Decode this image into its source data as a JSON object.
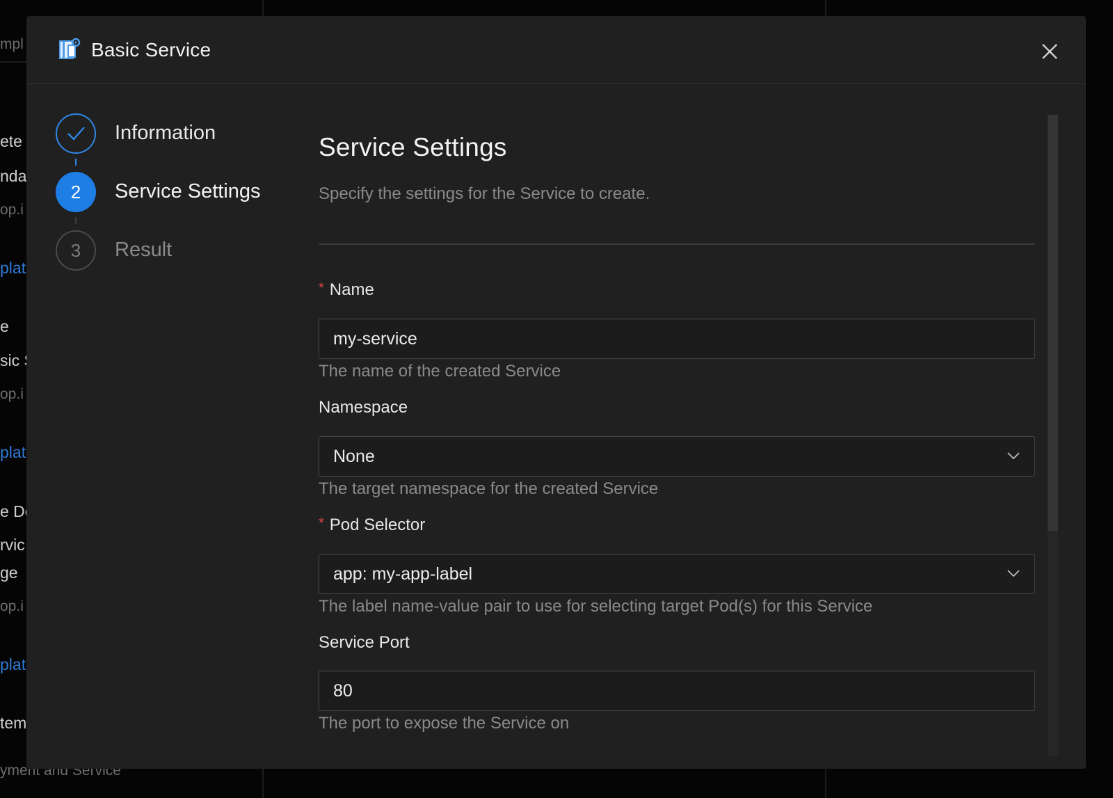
{
  "background": {
    "texts": [
      "mpl",
      "ete",
      "nda",
      "op.i",
      "plate",
      "e",
      "sic S",
      "op.i",
      "plate",
      "e De",
      "rvic",
      "ge",
      "op.i",
      "plate",
      "tem",
      "yment and Service"
    ]
  },
  "modal": {
    "title": "Basic Service",
    "app_icon": "template-gear-icon",
    "close_icon": "close-icon"
  },
  "steps": [
    {
      "number": "1",
      "label": "Information",
      "status": "done"
    },
    {
      "number": "2",
      "label": "Service Settings",
      "status": "active"
    },
    {
      "number": "3",
      "label": "Result",
      "status": "pending"
    }
  ],
  "section": {
    "title": "Service Settings",
    "description": "Specify the settings for the Service to create."
  },
  "fields": {
    "name": {
      "label": "Name",
      "required": true,
      "value": "my-service",
      "helper": "The name of the created Service"
    },
    "namespace": {
      "label": "Namespace",
      "required": false,
      "value": "None",
      "helper": "The target namespace for the created Service"
    },
    "pod_selector": {
      "label": "Pod Selector",
      "required": true,
      "value": "app: my-app-label",
      "helper": "The label name-value pair to use for selecting target Pod(s) for this Service"
    },
    "service_port": {
      "label": "Service Port",
      "required": false,
      "value": "80",
      "helper": "The port to expose the Service on"
    }
  },
  "required_marker": "*",
  "colors": {
    "accent": "#1f7ee6",
    "required": "#e5484d",
    "modal_bg": "#202020"
  }
}
